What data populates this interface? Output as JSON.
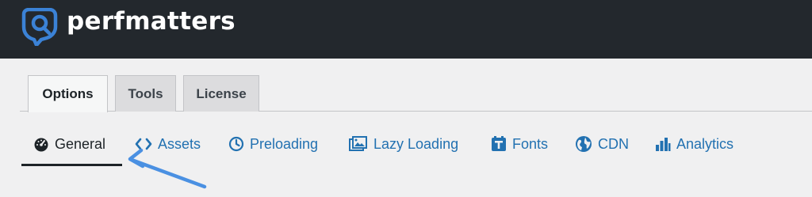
{
  "app": {
    "brand": "perfmatters"
  },
  "tabs": [
    {
      "label": "Options",
      "active": true
    },
    {
      "label": "Tools",
      "active": false
    },
    {
      "label": "License",
      "active": false
    }
  ],
  "subnav": [
    {
      "label": "General",
      "icon": "gauge-icon",
      "active": true
    },
    {
      "label": "Assets",
      "icon": "code-icon",
      "active": false
    },
    {
      "label": "Preloading",
      "icon": "clock-icon",
      "active": false
    },
    {
      "label": "Lazy Loading",
      "icon": "images-icon",
      "active": false
    },
    {
      "label": "Fonts",
      "icon": "font-icon",
      "active": false
    },
    {
      "label": "CDN",
      "icon": "globe-icon",
      "active": false
    },
    {
      "label": "Analytics",
      "icon": "bar-chart-icon",
      "active": false
    }
  ],
  "annotation": {
    "arrow_color": "#4a90e2"
  },
  "colors": {
    "header_bg": "#23282d",
    "link": "#2271b1",
    "page_bg": "#f0f0f1"
  }
}
